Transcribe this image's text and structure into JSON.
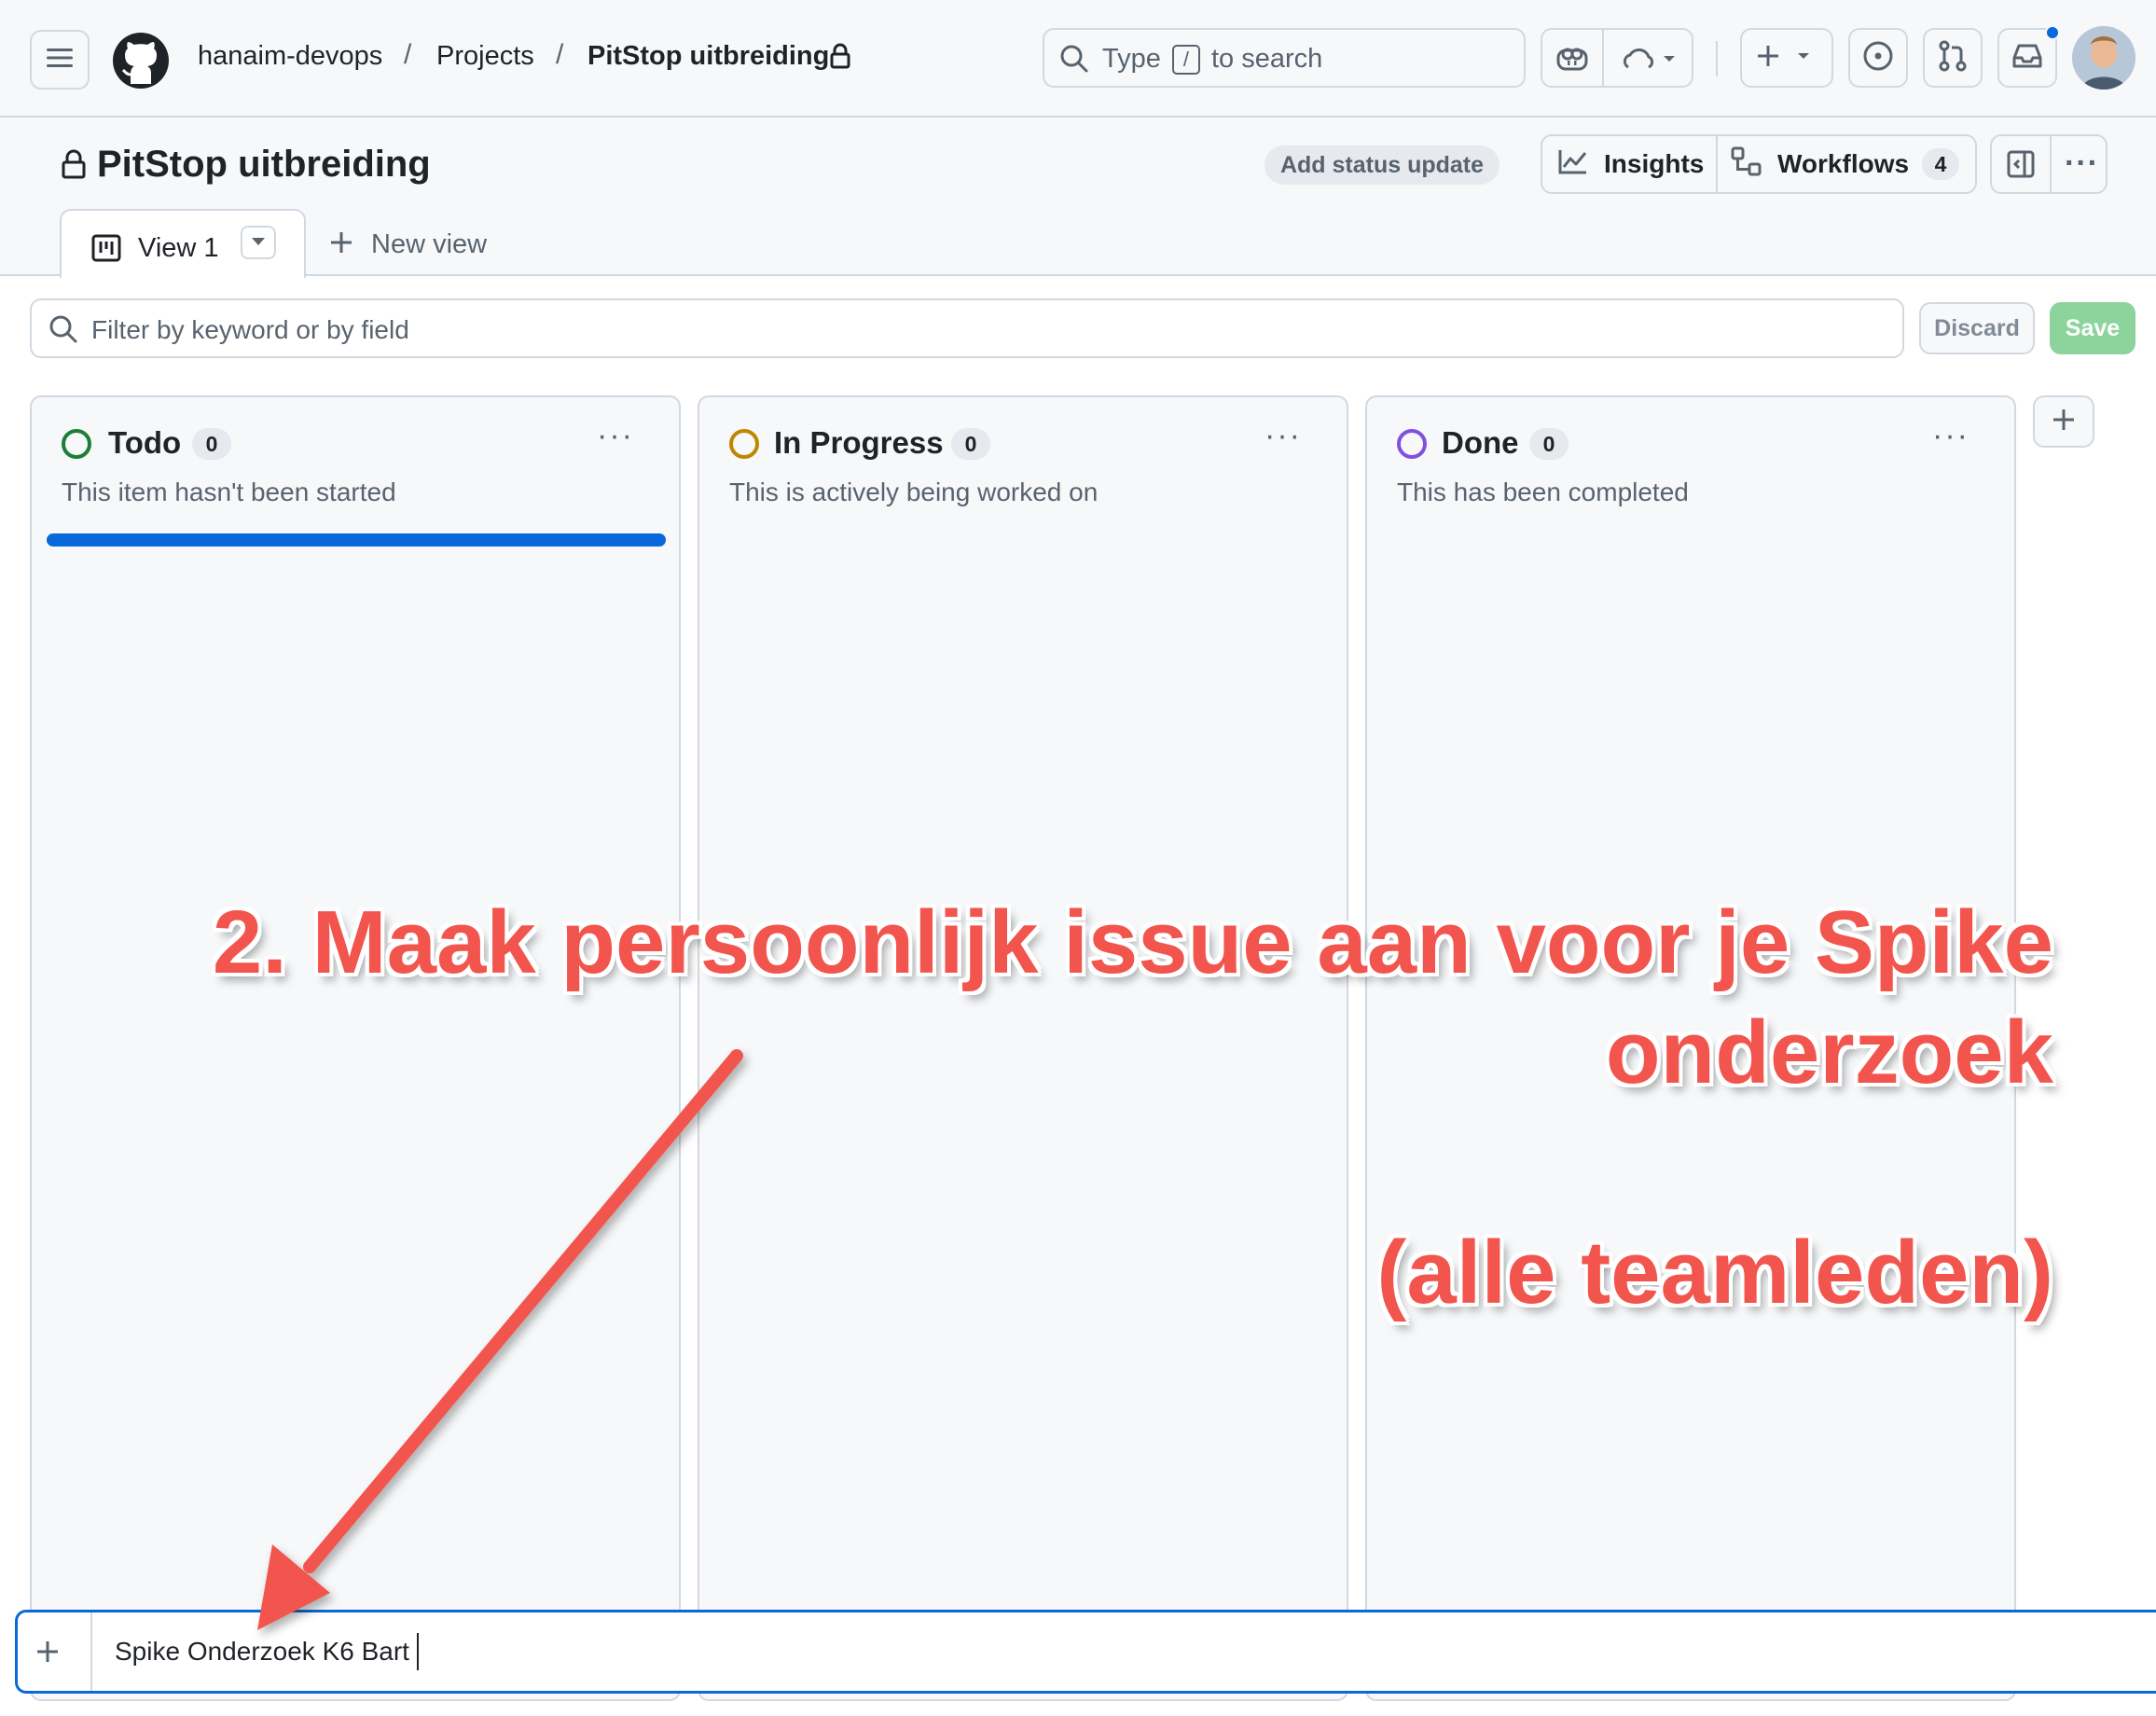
{
  "topbar": {
    "breadcrumb": [
      "hanaim-devops",
      "Projects",
      "PitStop uitbreiding"
    ],
    "separator": "/",
    "search": {
      "before": "Type",
      "key": "/",
      "after": "to search"
    }
  },
  "header": {
    "title": "PitStop uitbreiding",
    "status_update_label": "Add status update",
    "insights_label": "Insights",
    "workflows_label": "Workflows",
    "workflows_count": "4"
  },
  "tabs": {
    "active_label": "View 1",
    "new_view_label": "New view"
  },
  "filter": {
    "placeholder": "Filter by keyword or by field",
    "discard_label": "Discard",
    "save_label": "Save"
  },
  "columns": [
    {
      "title": "Todo",
      "count": "0",
      "description": "This item hasn't been started",
      "color": "#1a7f37"
    },
    {
      "title": "In Progress",
      "count": "0",
      "description": "This is actively being worked on",
      "color": "#9a6700"
    },
    {
      "title": "Done",
      "count": "0",
      "description": "This has been completed",
      "color": "#8250df"
    }
  ],
  "new_item": {
    "value": "Spike Onderzoek K6 Bart"
  },
  "annotation": {
    "line1": "2. Maak persoonlijk issue aan voor je Spike",
    "line2": "onderzoek",
    "line3": "(alle teamleden)"
  },
  "colors": {
    "accent": "#0969da",
    "save": "#8cd49b",
    "annotation": "#f2554d"
  }
}
